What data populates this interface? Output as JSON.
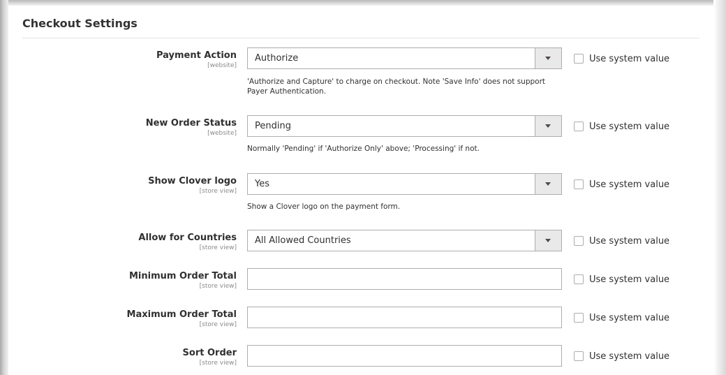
{
  "section": {
    "title": "Checkout Settings"
  },
  "system_value_label": "Use system value",
  "fields": [
    {
      "label": "Payment Action",
      "scope": "[website]",
      "type": "select",
      "value": "Authorize",
      "note": "'Authorize and Capture' to charge on checkout. Note 'Save Info' does not support Payer Authentication."
    },
    {
      "label": "New Order Status",
      "scope": "[website]",
      "type": "select",
      "value": "Pending",
      "note": "Normally 'Pending' if 'Authorize Only' above; 'Processing' if not."
    },
    {
      "label": "Show Clover logo",
      "scope": "[store view]",
      "type": "select",
      "value": "Yes",
      "note": "Show a Clover logo on the payment form."
    },
    {
      "label": "Allow for Countries",
      "scope": "[store view]",
      "type": "select",
      "value": "All Allowed Countries"
    },
    {
      "label": "Minimum Order Total",
      "scope": "[store view]",
      "type": "text",
      "value": ""
    },
    {
      "label": "Maximum Order Total",
      "scope": "[store view]",
      "type": "text",
      "value": ""
    },
    {
      "label": "Sort Order",
      "scope": "[store view]",
      "type": "text",
      "value": ""
    }
  ],
  "icons": {
    "dropdown": "chevron-down-icon",
    "checkbox": "checkbox-unchecked"
  },
  "colors": {
    "border": "#adadad",
    "arrow_bg": "#e9e9e9",
    "text": "#303030",
    "scope_text": "#8a8a8a"
  }
}
